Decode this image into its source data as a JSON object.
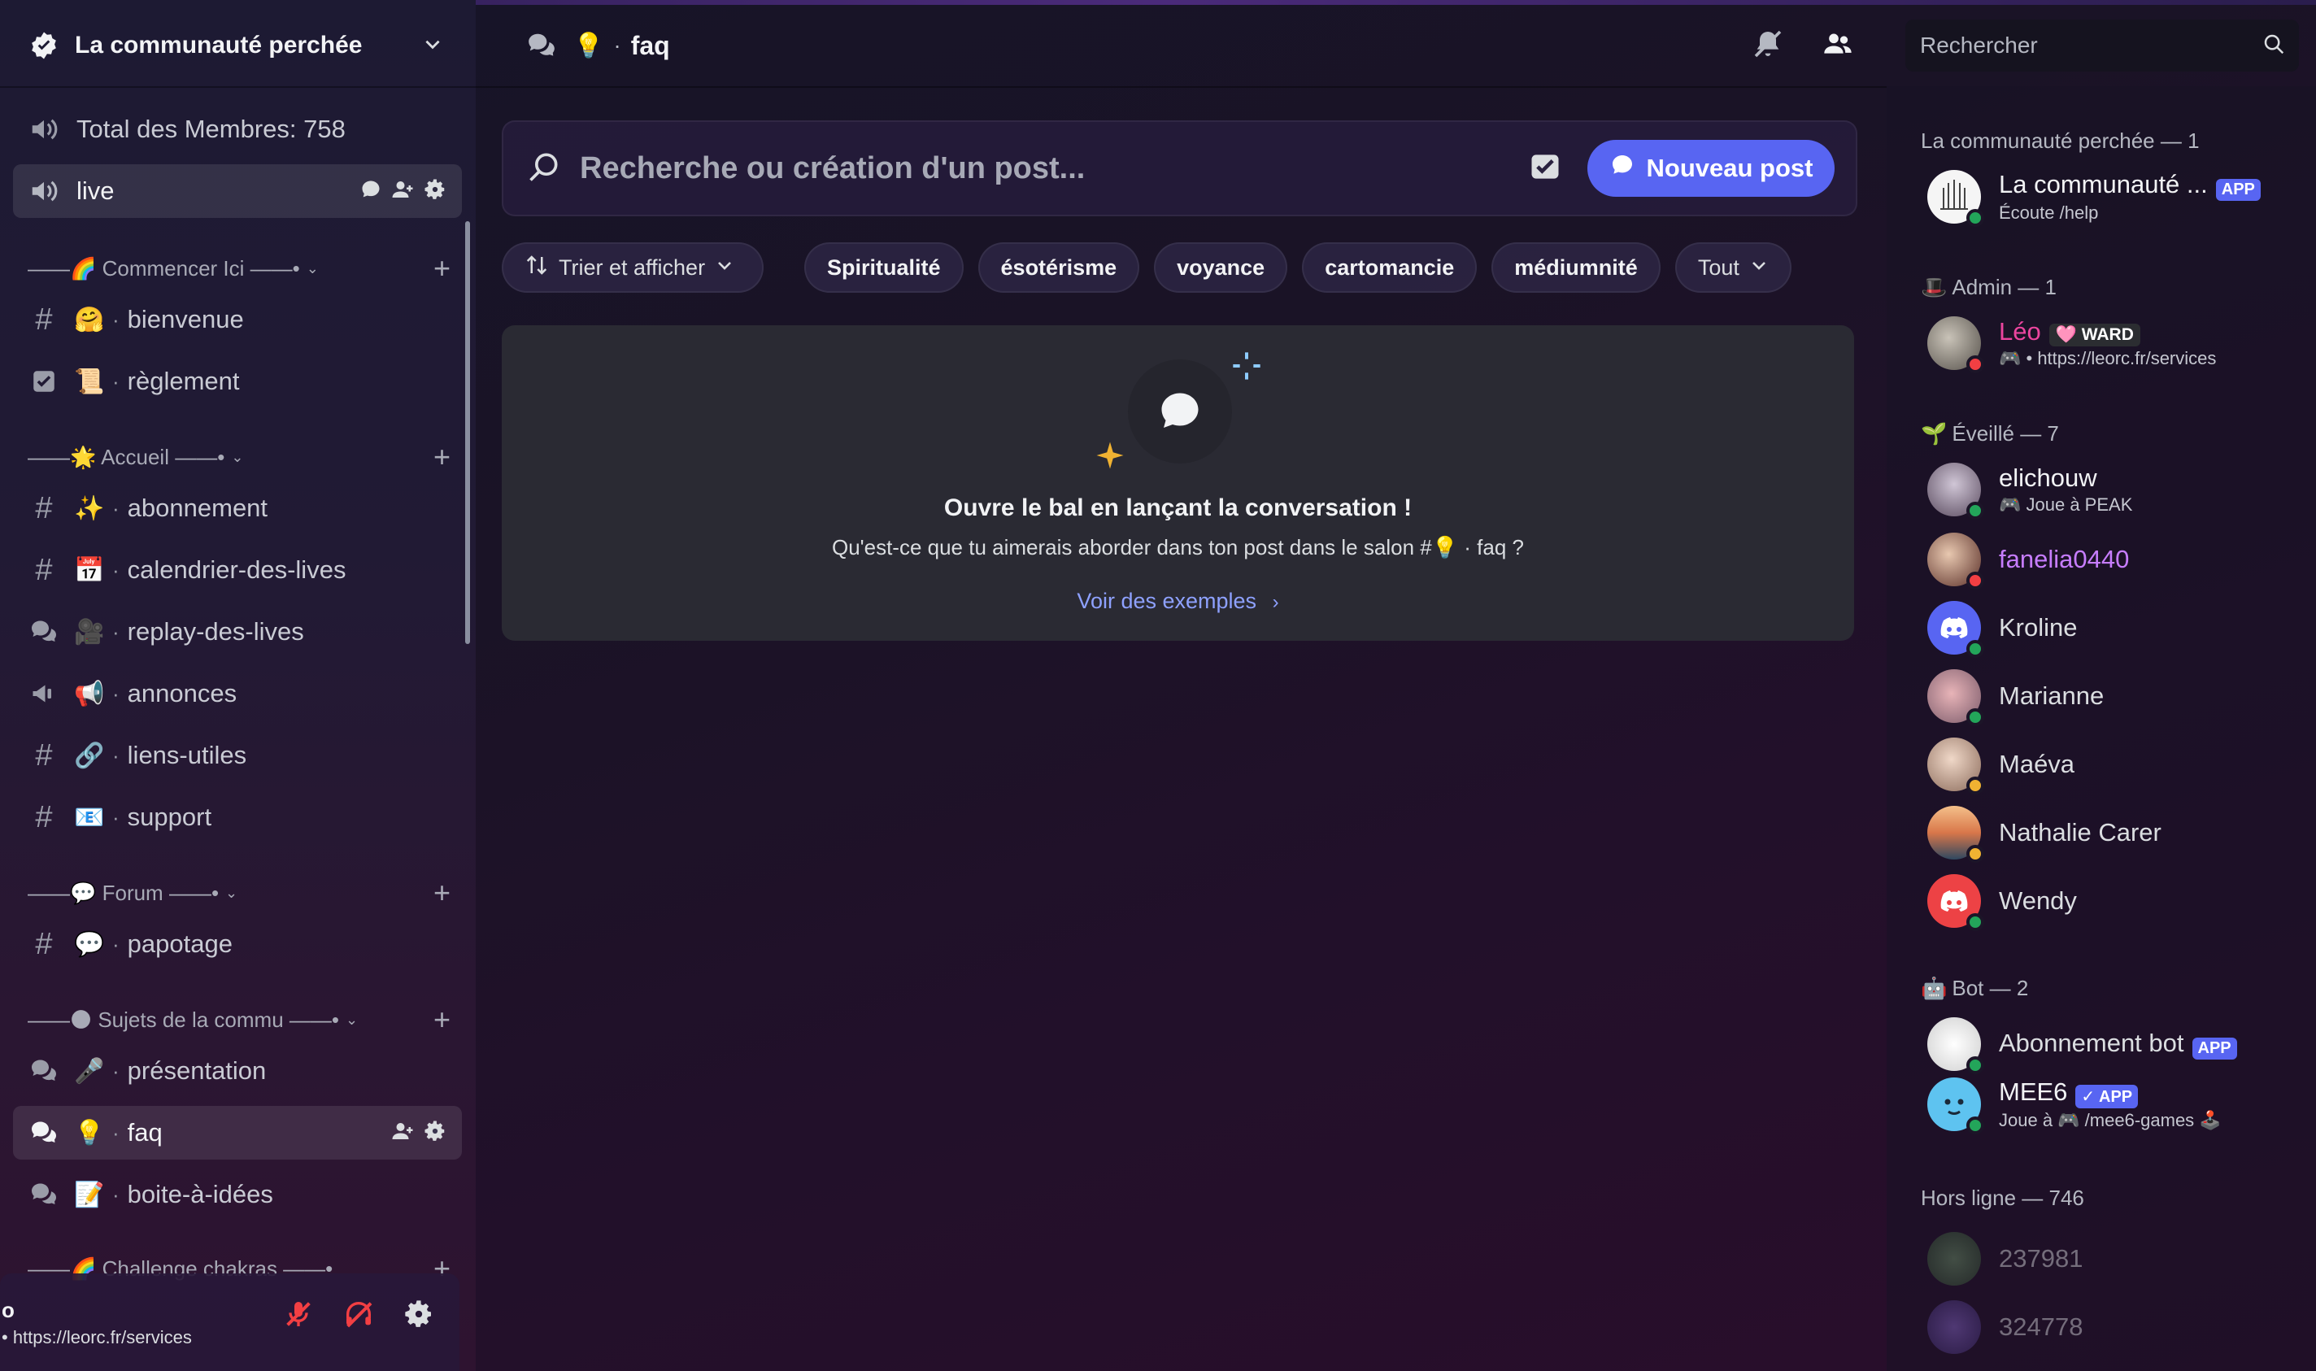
{
  "server": {
    "name": "La communauté perchée"
  },
  "sidebar": {
    "channels_top": [
      {
        "label": "Total des Membres: 758"
      },
      {
        "label": "live"
      }
    ],
    "categories": [
      {
        "label": "——🌈 Commencer Ici ——•",
        "channels": [
          {
            "emoji": "🤗",
            "label": "bienvenue"
          },
          {
            "emoji": "📜",
            "label": "règlement"
          }
        ]
      },
      {
        "label": "——🌟 Accueil ——•",
        "channels": [
          {
            "emoji": "✨",
            "label": "abonnement"
          },
          {
            "emoji": "📅",
            "label": "calendrier-des-lives"
          },
          {
            "emoji": "🎥",
            "label": "replay-des-lives"
          },
          {
            "emoji": "📢",
            "label": "annonces"
          },
          {
            "emoji": "🔗",
            "label": "liens-utiles"
          },
          {
            "emoji": "📧",
            "label": "support"
          }
        ]
      },
      {
        "label": "——💬 Forum ——•",
        "channels": [
          {
            "emoji": "💬",
            "label": "papotage"
          }
        ]
      },
      {
        "label": "——🌑 Sujets de la commu ——•",
        "channels": [
          {
            "emoji": "🎤",
            "label": "présentation"
          },
          {
            "emoji": "💡",
            "label": "faq"
          },
          {
            "emoji": "📝",
            "label": "boite-à-idées"
          }
        ]
      },
      {
        "label": "——🌈 Challenge chakras ——•"
      }
    ],
    "sep": "·"
  },
  "user_panel": {
    "name": "o",
    "status": "• https://leorc.fr/services"
  },
  "header": {
    "bulb": "💡",
    "sep": "·",
    "title": "faq",
    "search_placeholder": "Rechercher"
  },
  "forum": {
    "search_placeholder": "Recherche ou création d'un post...",
    "new_post": "Nouveau post",
    "sort_label": "Trier et afficher",
    "tags": [
      "Spiritualité",
      "ésotérisme",
      "voyance",
      "cartomancie",
      "médiumnité"
    ],
    "all_label": "Tout",
    "empty_title": "Ouvre le bal en lançant la conversation !",
    "empty_sub": "Qu'est-ce que tu aimerais aborder dans ton post dans le salon #💡 · faq ?",
    "examples": "Voir des exemples"
  },
  "members": {
    "groups": [
      {
        "label": "La communauté perchée — 1"
      },
      {
        "label": "Admin — 1",
        "emoji": "🎩"
      },
      {
        "label": "Éveillé — 7",
        "emoji": "🌱"
      },
      {
        "label": "Bot — 2",
        "emoji": "🤖"
      },
      {
        "label": "Hors ligne — 746"
      }
    ],
    "list": [
      {
        "name": "La communauté ...",
        "tag": "APP",
        "sub": "Écoute /help"
      },
      {
        "name": "Léo",
        "badge": "🩷 WARD",
        "sub": "🎮 • https://leorc.fr/services"
      },
      {
        "name": "elichouw",
        "sub": "🎮 Joue à PEAK"
      },
      {
        "name": "fanelia0440"
      },
      {
        "name": "Kroline"
      },
      {
        "name": "Marianne"
      },
      {
        "name": "Maéva"
      },
      {
        "name": "Nathalie Carer"
      },
      {
        "name": "Wendy"
      },
      {
        "name": "Abonnement bot",
        "tag": "APP"
      },
      {
        "name": "MEE6",
        "tag": "✓ APP",
        "sub": "Joue à 🎮 /mee6-games 🕹️"
      },
      {
        "name": "237981"
      },
      {
        "name": "324778"
      }
    ]
  },
  "colors": {
    "accent": "#5865f2",
    "online": "#23a55a",
    "dnd": "#f23f43",
    "idle": "#f0b232",
    "leo": "#eb459e",
    "fanelia": "#c77dff"
  }
}
